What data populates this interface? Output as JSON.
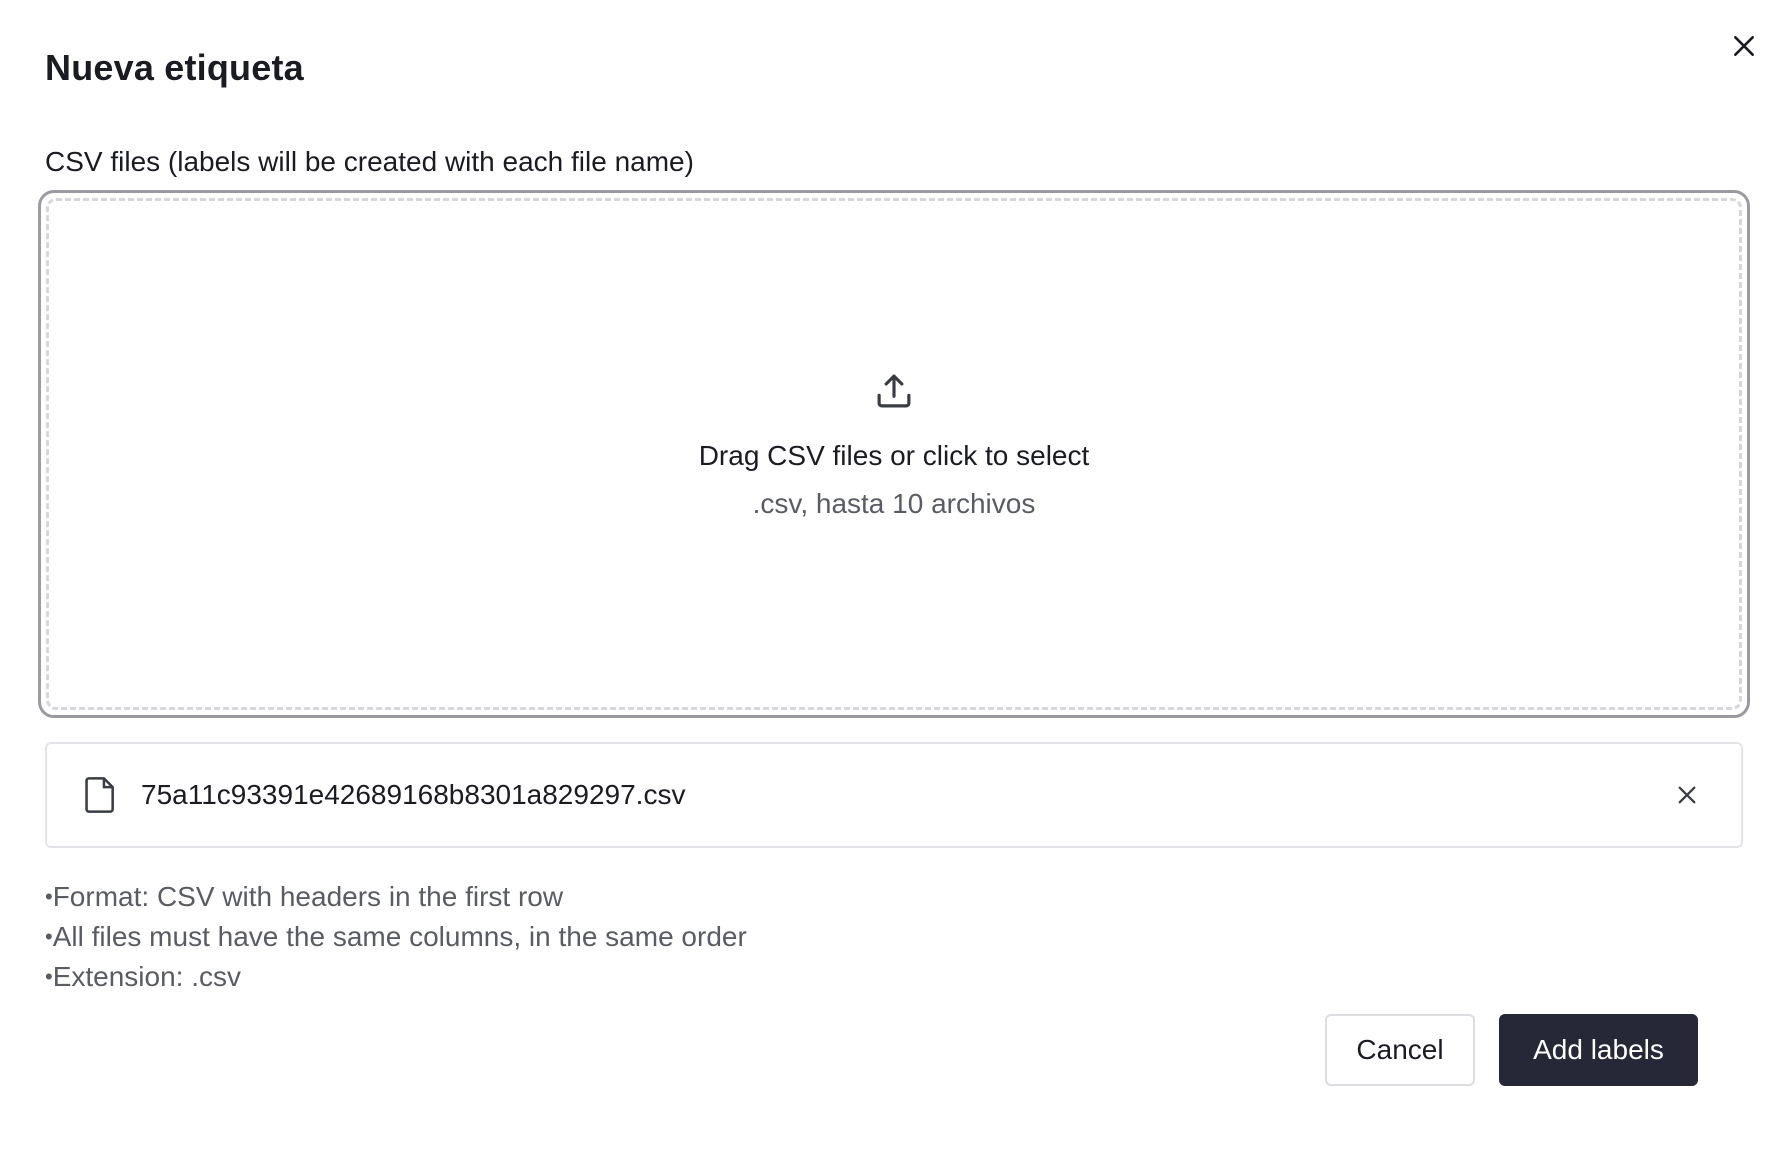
{
  "dialog": {
    "title": "Nueva etiqueta",
    "close_icon": "close-icon"
  },
  "upload": {
    "field_label": "CSV files (labels will be created with each file name)",
    "icon": "upload-icon",
    "main_text": "Drag CSV files or click to select",
    "sub_text": ".csv, hasta 10 archivos"
  },
  "files": [
    {
      "icon": "file-icon",
      "name": "75a11c93391e42689168b8301a829297.csv",
      "remove_icon": "close-icon"
    }
  ],
  "notes": [
    "Format: CSV with headers in the first row",
    "All files must have the same columns, in the same order",
    "Extension: .csv"
  ],
  "actions": {
    "cancel_label": "Cancel",
    "submit_label": "Add labels"
  },
  "colors": {
    "primary_button": "#262837",
    "text": "#1b1c22",
    "muted_text": "#5a5c63"
  }
}
